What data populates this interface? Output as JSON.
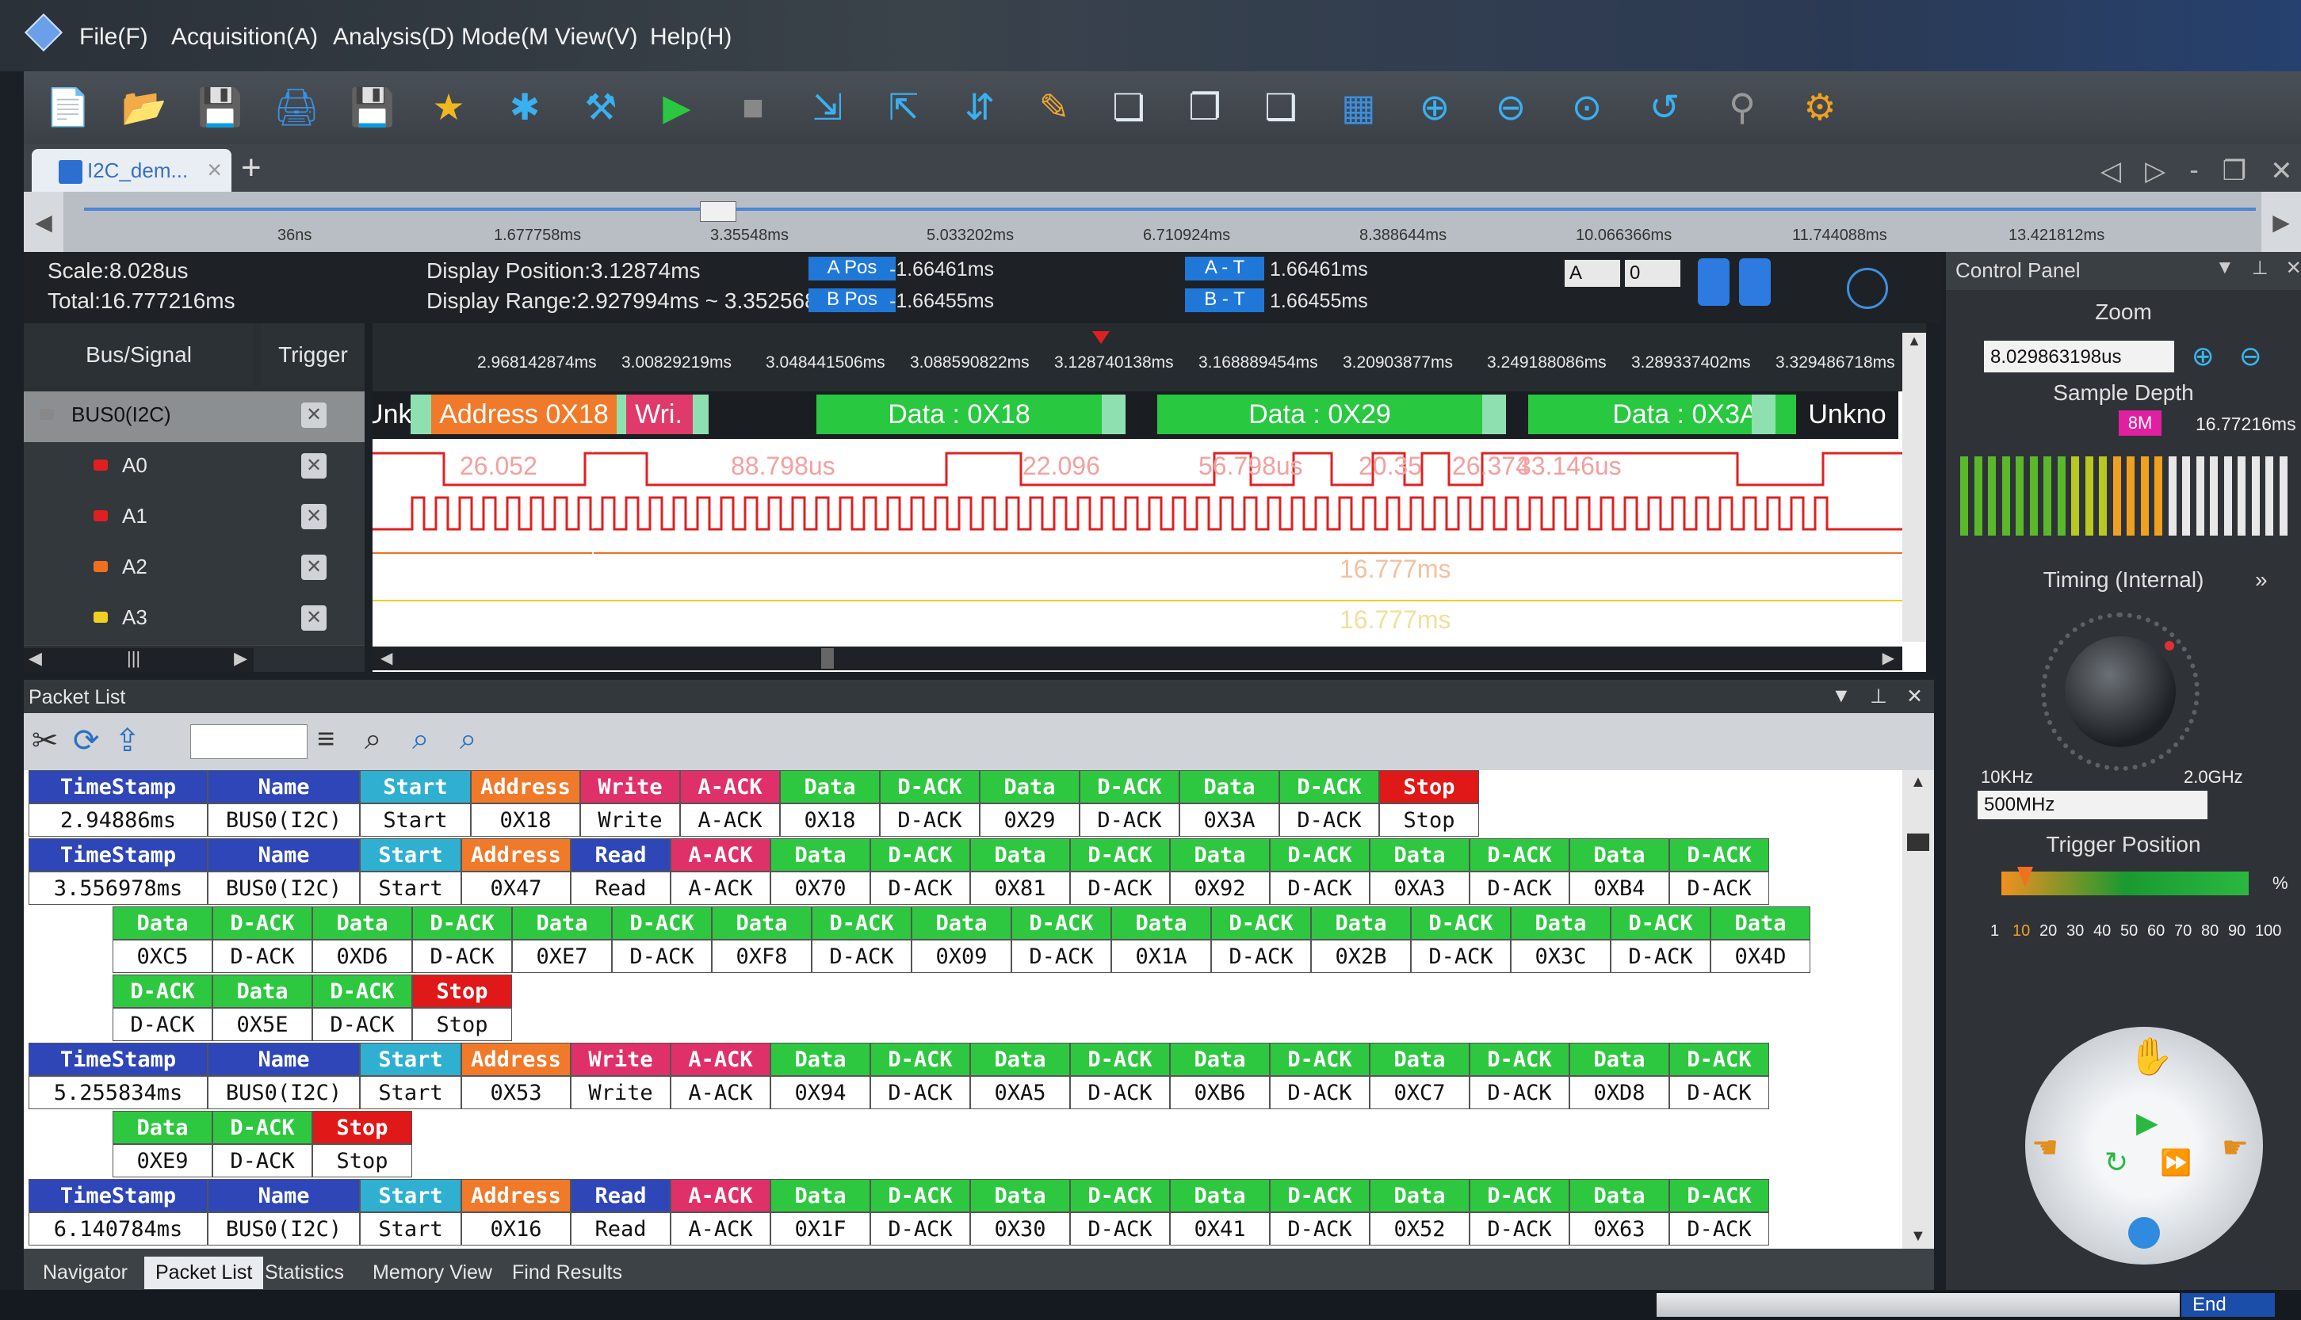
{
  "menu": [
    "File(F)",
    "Acquisition(A)",
    "Analysis(D)",
    "Mode(M",
    "View(V)",
    "Help(H)"
  ],
  "toolbar_icons": [
    "new-file-icon",
    "open-folder-icon",
    "save-icon",
    "print-icon",
    "save-as-icon",
    "star-icon",
    "device-icon",
    "tools-icon",
    "run-icon",
    "stop-icon",
    "cursor-add-icon",
    "cursor-icon",
    "cursor-marker-icon",
    "probe-icon",
    "copy-icon",
    "paste-icon",
    "clipboard-icon",
    "binary-icon",
    "zoom-in-icon",
    "zoom-out-icon",
    "zoom-fit-icon",
    "refresh-icon",
    "pin-icon",
    "settings-icon"
  ],
  "tab": {
    "title": "I2C_dem...",
    "close": "×",
    "add": "+"
  },
  "overview": {
    "ticks": [
      "36ns",
      "1.677758ms",
      "3.35548ms",
      "5.033202ms",
      "6.710924ms",
      "8.388644ms",
      "10.066366ms",
      "11.744088ms",
      "13.421812ms"
    ]
  },
  "info": {
    "scale": "Scale:8.028us",
    "total": "Total:16.777216ms",
    "display_position": "Display Position:3.12874ms",
    "display_range": "Display Range:2.927994ms ~ 3.352568ms",
    "a_pos_label": "A Pos",
    "a_pos_value": "-1.66461ms",
    "b_pos_label": "B Pos",
    "b_pos_value": "-1.66455ms",
    "at_label": "A - T",
    "at_value": "1.66461ms",
    "bt_label": "B - T",
    "bt_value": "1.66455ms",
    "sel_a": "A",
    "sel_0": "0"
  },
  "signals": {
    "header_bus": "Bus/Signal",
    "header_trigger": "Trigger",
    "rows": [
      {
        "name": "BUS0(I2C)",
        "color": "#888888"
      },
      {
        "name": "A0",
        "color": "#e02020"
      },
      {
        "name": "A1",
        "color": "#e02020"
      },
      {
        "name": "A2",
        "color": "#f07020"
      },
      {
        "name": "A3",
        "color": "#f0d020"
      }
    ]
  },
  "ruler": [
    "2.968142874ms",
    "3.00829219ms",
    "3.048441506ms",
    "3.088590822ms",
    "3.128740138ms",
    "3.168889454ms",
    "3.20903877ms",
    "3.249188086ms",
    "3.289337402ms",
    "3.329486718ms"
  ],
  "bus_segments": [
    {
      "text": "Unk.",
      "color": "#1a1e22",
      "fg": "#ffffff"
    },
    {
      "text": "Address  0X18",
      "color": "#f07a2a",
      "fg": "#ffffff"
    },
    {
      "text": "Wri.",
      "color": "#e03a6a",
      "fg": "#ffffff"
    },
    {
      "text": "Data : 0X18",
      "color": "#28c840",
      "fg": "#ffffff"
    },
    {
      "text": "Data : 0X29",
      "color": "#28c840",
      "fg": "#ffffff"
    },
    {
      "text": "Data : 0X3A",
      "color": "#28c840",
      "fg": "#ffffff"
    },
    {
      "text": "Unkno",
      "color": "#1a1e22",
      "fg": "#ffffff"
    }
  ],
  "wave_labels": {
    "a0": [
      "26.052",
      "88.798us",
      "22.096",
      "56.798us",
      "20.35",
      "26.374",
      "33.146us"
    ],
    "a2": "16.777ms",
    "a3": "16.777ms"
  },
  "control_panel": {
    "title": "Control Panel",
    "zoom_label": "Zoom",
    "zoom_value": "8.029863198us",
    "sample_depth_label": "Sample Depth",
    "depth_badge": "8M",
    "depth_value": "16.77216ms",
    "depth_level": 0.6,
    "timing_label": "Timing (Internal)",
    "freq_min": "10KHz",
    "freq_max": "2.0GHz",
    "freq_select": "500MHz",
    "trigger_position_label": "Trigger Position",
    "trigger_percent": "%",
    "trigger_scale": [
      "1",
      "10",
      "20",
      "30",
      "40",
      "50",
      "60",
      "70",
      "80",
      "90",
      "100"
    ],
    "trigger_value": 10
  },
  "packet_list": {
    "title": "Packet List",
    "bottom_tabs": [
      "Navigator",
      "Packet List",
      "Statistics",
      "Memory View",
      "Find Results"
    ],
    "header_colors": {
      "TimeStamp": "#2f46b8",
      "Name": "#2f46b8",
      "Start": "#30b0d0",
      "Address": "#f07a2a",
      "Write": "#e0306a",
      "Read": "#2f46b8",
      "A-ACK": "#e0306a",
      "Data": "#2ec840",
      "D-ACK": "#2ec840",
      "Stop": "#e01818"
    },
    "rows": [
      {
        "indent": 0,
        "cells": [
          [
            "TimeStamp",
            "2.94886ms"
          ],
          [
            "Name",
            "BUS0(I2C)"
          ],
          [
            "Start",
            "Start"
          ],
          [
            "Address",
            "0X18"
          ],
          [
            "Write",
            "Write"
          ],
          [
            "A-ACK",
            "A-ACK"
          ],
          [
            "Data",
            "0X18"
          ],
          [
            "D-ACK",
            "D-ACK"
          ],
          [
            "Data",
            "0X29"
          ],
          [
            "D-ACK",
            "D-ACK"
          ],
          [
            "Data",
            "0X3A"
          ],
          [
            "D-ACK",
            "D-ACK"
          ],
          [
            "Stop",
            "Stop"
          ]
        ]
      },
      {
        "indent": 0,
        "cells": [
          [
            "TimeStamp",
            "3.556978ms"
          ],
          [
            "Name",
            "BUS0(I2C)"
          ],
          [
            "Start",
            "Start"
          ],
          [
            "Address",
            "0X47"
          ],
          [
            "Read",
            "Read"
          ],
          [
            "A-ACK",
            "A-ACK"
          ],
          [
            "Data",
            "0X70"
          ],
          [
            "D-ACK",
            "D-ACK"
          ],
          [
            "Data",
            "0X81"
          ],
          [
            "D-ACK",
            "D-ACK"
          ],
          [
            "Data",
            "0X92"
          ],
          [
            "D-ACK",
            "D-ACK"
          ],
          [
            "Data",
            "0XA3"
          ],
          [
            "D-ACK",
            "D-ACK"
          ],
          [
            "Data",
            "0XB4"
          ],
          [
            "D-ACK",
            "D-ACK"
          ]
        ]
      },
      {
        "indent": 1,
        "cells": [
          [
            "Data",
            "0XC5"
          ],
          [
            "D-ACK",
            "D-ACK"
          ],
          [
            "Data",
            "0XD6"
          ],
          [
            "D-ACK",
            "D-ACK"
          ],
          [
            "Data",
            "0XE7"
          ],
          [
            "D-ACK",
            "D-ACK"
          ],
          [
            "Data",
            "0XF8"
          ],
          [
            "D-ACK",
            "D-ACK"
          ],
          [
            "Data",
            "0X09"
          ],
          [
            "D-ACK",
            "D-ACK"
          ],
          [
            "Data",
            "0X1A"
          ],
          [
            "D-ACK",
            "D-ACK"
          ],
          [
            "Data",
            "0X2B"
          ],
          [
            "D-ACK",
            "D-ACK"
          ],
          [
            "Data",
            "0X3C"
          ],
          [
            "D-ACK",
            "D-ACK"
          ],
          [
            "Data",
            "0X4D"
          ]
        ]
      },
      {
        "indent": 1,
        "cells": [
          [
            "D-ACK",
            "D-ACK"
          ],
          [
            "Data",
            "0X5E"
          ],
          [
            "D-ACK",
            "D-ACK"
          ],
          [
            "Stop",
            "Stop"
          ]
        ]
      },
      {
        "indent": 0,
        "cells": [
          [
            "TimeStamp",
            "5.255834ms"
          ],
          [
            "Name",
            "BUS0(I2C)"
          ],
          [
            "Start",
            "Start"
          ],
          [
            "Address",
            "0X53"
          ],
          [
            "Write",
            "Write"
          ],
          [
            "A-ACK",
            "A-ACK"
          ],
          [
            "Data",
            "0X94"
          ],
          [
            "D-ACK",
            "D-ACK"
          ],
          [
            "Data",
            "0XA5"
          ],
          [
            "D-ACK",
            "D-ACK"
          ],
          [
            "Data",
            "0XB6"
          ],
          [
            "D-ACK",
            "D-ACK"
          ],
          [
            "Data",
            "0XC7"
          ],
          [
            "D-ACK",
            "D-ACK"
          ],
          [
            "Data",
            "0XD8"
          ],
          [
            "D-ACK",
            "D-ACK"
          ]
        ]
      },
      {
        "indent": 1,
        "cells": [
          [
            "Data",
            "0XE9"
          ],
          [
            "D-ACK",
            "D-ACK"
          ],
          [
            "Stop",
            "Stop"
          ]
        ]
      },
      {
        "indent": 0,
        "cells": [
          [
            "TimeStamp",
            "6.140784ms"
          ],
          [
            "Name",
            "BUS0(I2C)"
          ],
          [
            "Start",
            "Start"
          ],
          [
            "Address",
            "0X16"
          ],
          [
            "Read",
            "Read"
          ],
          [
            "A-ACK",
            "A-ACK"
          ],
          [
            "Data",
            "0X1F"
          ],
          [
            "D-ACK",
            "D-ACK"
          ],
          [
            "Data",
            "0X30"
          ],
          [
            "D-ACK",
            "D-ACK"
          ],
          [
            "Data",
            "0X41"
          ],
          [
            "D-ACK",
            "D-ACK"
          ],
          [
            "Data",
            "0X52"
          ],
          [
            "D-ACK",
            "D-ACK"
          ],
          [
            "Data",
            "0X63"
          ],
          [
            "D-ACK",
            "D-ACK"
          ]
        ]
      }
    ]
  },
  "status": {
    "end_label": "End"
  }
}
